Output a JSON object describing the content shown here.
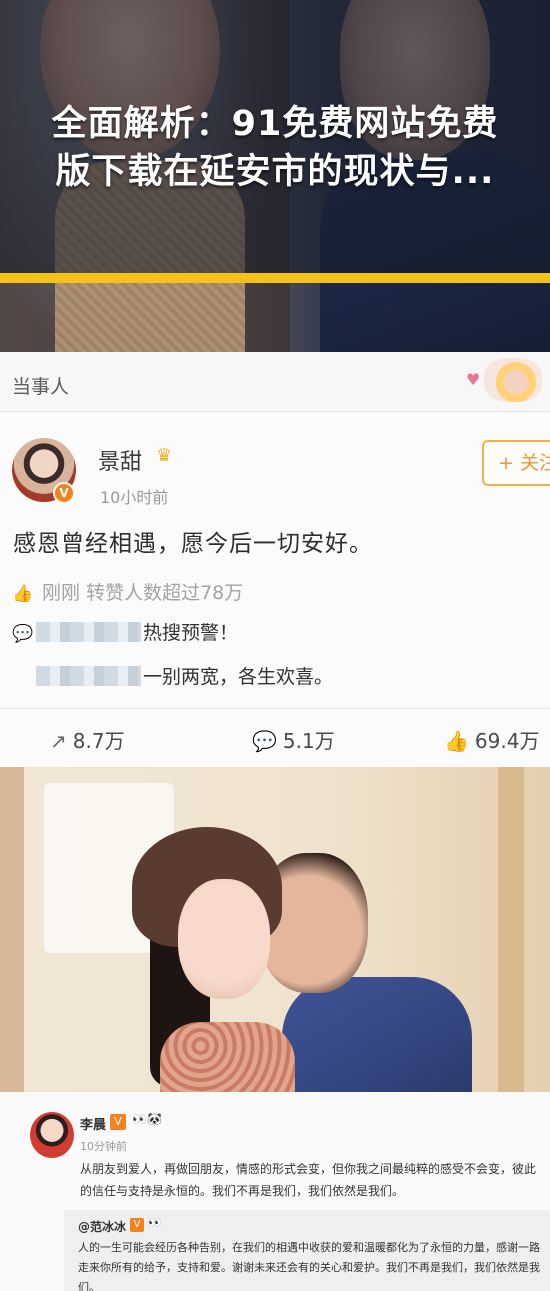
{
  "banner": {
    "title_line1": "全面解析：91免费网站免费",
    "title_line2": "版下载在延安市的现状与...",
    "stripe_color": "#f4c21a"
  },
  "section": {
    "title": "当事人",
    "heart": "♥"
  },
  "post": {
    "user_name": "景甜",
    "crown_icon": "crown-icon",
    "verified": "V",
    "time": "10小时前",
    "follow_label": "+ 关注",
    "text": "感恩曾经相遇，愿今后一切安好。",
    "meta": [
      {
        "icon": "👍",
        "text": "刚刚 转赞人数超过78万"
      },
      {
        "icon": "💬",
        "text": "热搜预警！"
      },
      {
        "icon": "",
        "text": "一别两宽，各生欢喜。"
      }
    ],
    "actions": {
      "repost": {
        "icon": "↗",
        "count": "8.7万"
      },
      "comment": {
        "icon": "💬",
        "count": "5.1万"
      },
      "like": {
        "icon": "👍",
        "count": "69.4万"
      }
    },
    "accent_color": "#f2b04a"
  },
  "repost": {
    "user_name": "李晨",
    "verified": "V",
    "emoji": "👀🐼",
    "time": "10分钟前",
    "text": "从朋友到爱人，再做回朋友，情感的形式会变，但你我之间最纯粹的感受不会变，彼此的信任与支持是永恒的。我们不再是我们，我们依然是我们。",
    "quote": {
      "user_name": "@范冰冰",
      "verified": "V",
      "emoji": "👀",
      "text": "人的一生可能会经历各种告别，在我们的相遇中收获的爱和温暖都化为了永恒的力量，感谢一路走来你所有的给予，支持和爱。谢谢未来还会有的关心和爱护。我们不再是我们，我们依然是我们。"
    }
  }
}
